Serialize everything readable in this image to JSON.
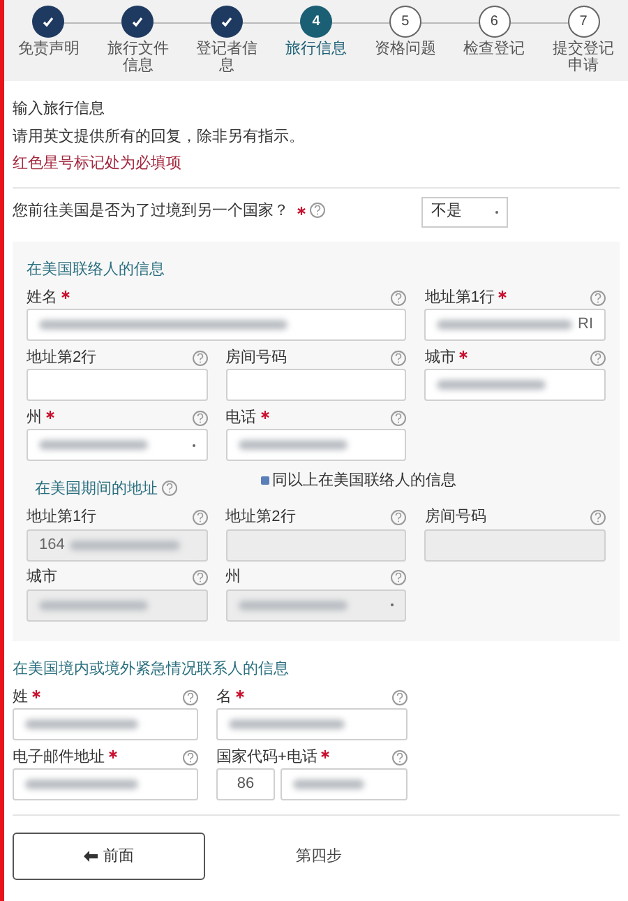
{
  "steps": [
    {
      "label": "免责声明",
      "done": true,
      "selected": false
    },
    {
      "label": "旅行文件信息",
      "done": true,
      "selected": false
    },
    {
      "label": "登记者信息",
      "done": true,
      "selected": false
    },
    {
      "number": "4",
      "label": "旅行信息",
      "done": false,
      "selected": true
    },
    {
      "number": "5",
      "label": "资格问题",
      "done": false,
      "selected": false
    },
    {
      "number": "6",
      "label": "检查登记",
      "done": false,
      "selected": false
    },
    {
      "number": "7",
      "label": "提交登记申请",
      "done": false,
      "selected": false
    }
  ],
  "intro": {
    "title": "输入旅行信息",
    "note": "请用英文提供所有的回复，除非另有指示。",
    "required_note": "红色星号标记处为必填项"
  },
  "question": {
    "label": "您前往美国是否为了过境到另一个国家？",
    "required": true,
    "help": true,
    "answer": "不是"
  },
  "contact": {
    "title": "在美国联络人的信息",
    "fields": [
      {
        "label": "姓名",
        "required": true,
        "help": true,
        "kind": "text",
        "wide": true,
        "blurred": true
      },
      {
        "label": "地址第1行",
        "required": true,
        "help": true,
        "kind": "text",
        "value": "RI",
        "blurred": true,
        "blur_before_value": true
      },
      {
        "label": "地址第2行",
        "required": false,
        "help": true,
        "kind": "text"
      },
      {
        "label": "房间号码",
        "required": false,
        "help": true,
        "kind": "text"
      },
      {
        "label": "城市",
        "required": true,
        "help": true,
        "kind": "text",
        "blurred": true
      },
      {
        "label": "州",
        "required": true,
        "help": true,
        "kind": "select",
        "blurred": true
      },
      {
        "label": "电话",
        "required": true,
        "help": true,
        "kind": "text",
        "blurred": true
      }
    ]
  },
  "address": {
    "title": "在美国期间的地址",
    "help": true,
    "same_as_contact": {
      "label": "同以上在美国联络人的信息",
      "checked": true
    },
    "fields": [
      {
        "label": "地址第1行",
        "required": false,
        "help": true,
        "kind": "text",
        "disabled": true,
        "value": "164",
        "blurred": true
      },
      {
        "label": "地址第2行",
        "required": false,
        "help": true,
        "kind": "text",
        "disabled": true
      },
      {
        "label": "房间号码",
        "required": false,
        "help": true,
        "kind": "text",
        "disabled": true
      },
      {
        "label": "城市",
        "required": false,
        "help": true,
        "kind": "text",
        "disabled": true,
        "blurred": true
      },
      {
        "label": "州",
        "required": false,
        "help": true,
        "kind": "select",
        "disabled": true,
        "blurred": true
      }
    ]
  },
  "emergency": {
    "title": "在美国境内或境外紧急情况联系人的信息",
    "fields": [
      {
        "label": "姓",
        "required": true,
        "help": true,
        "kind": "text",
        "blurred": true
      },
      {
        "label": "名",
        "required": true,
        "help": true,
        "kind": "text",
        "blurred": true
      },
      {
        "label": "电子邮件地址",
        "required": true,
        "help": true,
        "kind": "text",
        "blurred": true
      },
      {
        "label": "国家代码+电话",
        "required": true,
        "help": true,
        "kind": "phone",
        "code": "86",
        "blurred": true
      }
    ]
  },
  "footer": {
    "back_button": "前面",
    "step_text": "第四步"
  }
}
